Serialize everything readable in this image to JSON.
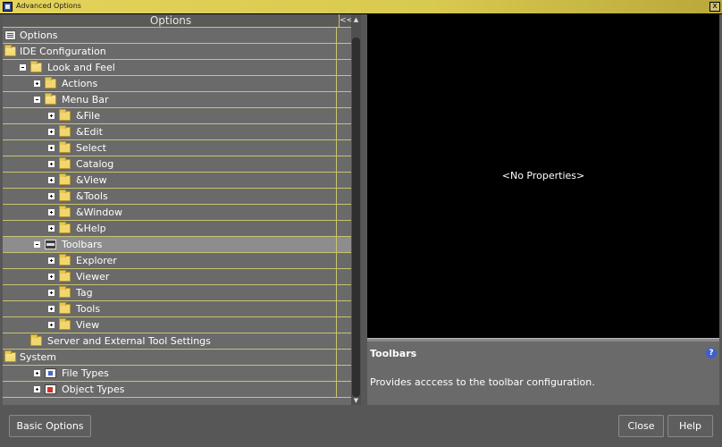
{
  "window": {
    "title": "Advanced Options",
    "close_glyph": "x"
  },
  "tree": {
    "header": "Options",
    "collapse_label": "<<",
    "rows": [
      {
        "label": "Options",
        "toggle": "none",
        "icon": "doc-icon",
        "level": 0
      },
      {
        "label": "IDE Configuration",
        "toggle": "minus",
        "icon": "folder-open-icon",
        "level": 0
      },
      {
        "label": "Look and Feel",
        "toggle": "minus",
        "icon": "folder-open-icon",
        "level": 1
      },
      {
        "label": "Actions",
        "toggle": "plus",
        "icon": "folder-icon",
        "level": 2
      },
      {
        "label": "Menu Bar",
        "toggle": "minus",
        "icon": "folder-open-icon",
        "level": 2
      },
      {
        "label": "&File",
        "toggle": "plus",
        "icon": "folder-icon",
        "level": 3
      },
      {
        "label": "&Edit",
        "toggle": "plus",
        "icon": "folder-icon",
        "level": 3
      },
      {
        "label": "Select",
        "toggle": "plus",
        "icon": "folder-icon",
        "level": 3
      },
      {
        "label": "Catalog",
        "toggle": "plus",
        "icon": "folder-icon",
        "level": 3
      },
      {
        "label": "&View",
        "toggle": "plus",
        "icon": "folder-icon",
        "level": 3
      },
      {
        "label": "&Tools",
        "toggle": "plus",
        "icon": "folder-icon",
        "level": 3
      },
      {
        "label": "&Window",
        "toggle": "plus",
        "icon": "folder-icon",
        "level": 3
      },
      {
        "label": "&Help",
        "toggle": "plus",
        "icon": "folder-icon",
        "level": 3
      },
      {
        "label": "Toolbars",
        "toggle": "minus",
        "icon": "toolbar-icon",
        "level": 2,
        "selected": true
      },
      {
        "label": "Explorer",
        "toggle": "plus",
        "icon": "folder-icon",
        "level": 3
      },
      {
        "label": "Viewer",
        "toggle": "plus",
        "icon": "folder-icon",
        "level": 3
      },
      {
        "label": "Tag",
        "toggle": "plus",
        "icon": "folder-icon",
        "level": 3
      },
      {
        "label": "Tools",
        "toggle": "plus",
        "icon": "folder-icon",
        "level": 3
      },
      {
        "label": "View",
        "toggle": "plus",
        "icon": "folder-icon",
        "level": 3
      },
      {
        "label": "Server and External Tool Settings",
        "toggle": "none",
        "icon": "folder-icon",
        "level": 1
      },
      {
        "label": "System",
        "toggle": "minus",
        "icon": "folder-open-icon",
        "level": 0
      },
      {
        "label": "File Types",
        "toggle": "plus",
        "icon": "file-types-icon",
        "level": 2
      },
      {
        "label": "Object Types",
        "toggle": "plus",
        "icon": "object-types-icon",
        "level": 2
      }
    ]
  },
  "properties": {
    "empty_text": "<No Properties>"
  },
  "description": {
    "title": "Toolbars",
    "text": "Provides acccess to the toolbar configuration.",
    "help_glyph": "?"
  },
  "buttons": {
    "basic": "Basic Options",
    "close": "Close",
    "help": "Help"
  },
  "colors": {
    "titlebar": "#d8c94f",
    "grid_line": "#c7c46e",
    "panel_bg": "#6a6a6a",
    "selected_row": "#8d8d8d",
    "properties_bg": "#000000"
  }
}
